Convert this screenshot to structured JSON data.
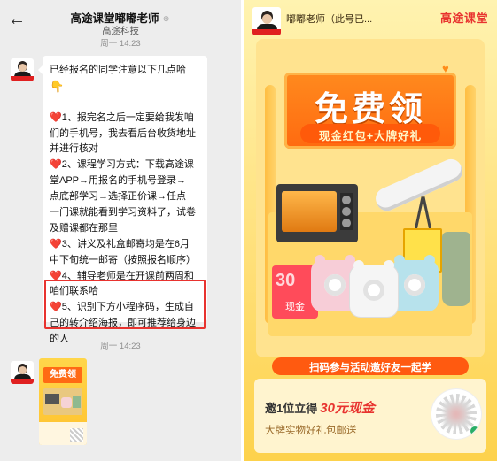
{
  "chat": {
    "title": "高途课堂嘟嘟老师",
    "subtitle": "高途科技",
    "time_top": "周一 14:23",
    "time_bottom": "周一 14:23",
    "back_icon": "←",
    "icons": {
      "back": "chevron-left-icon",
      "work_wechat": "workwechat-badge-icon",
      "heart": "red-heart-icon",
      "point": "point-down-icon"
    },
    "message_lines": [
      "已经报名的同学注意以下几点哈",
      "",
      "",
      "1、报完名之后一定要给我发咱",
      "们的手机号，我去看后台收货地址",
      "并进行核对",
      "2、课程学习方式：下载高途课",
      "堂APP→用报名的手机号登录→",
      "点底部学习→选择正价课→任点",
      "一门课就能看到学习资料了，试卷",
      "及赠课都在那里",
      "3、讲义及礼盒邮寄均是在6月",
      "中下旬统一邮寄（按照报名顺序）",
      "4、辅导老师是在开课前两周和",
      "咱们联系哈",
      "5、识别下方小程序码，生成自",
      "己的转介绍海报，即可推荐给身边",
      "的人"
    ],
    "heart_glyph": "❤️",
    "point_glyph": "👇",
    "highlight_color": "#e8332f",
    "mini_poster_title": "免费领"
  },
  "poster": {
    "teacher": "嘟嘟老师（此号已...",
    "brand": "高途课堂",
    "title": "免费领",
    "subtitle": "现金红包+大牌好礼",
    "coupon_value": "30",
    "coupon_label": "现金",
    "ribbon": "扫码参与活动邀好友一起学",
    "info_line1_prefix": "邀1位立得",
    "info_line1_amount": "30元现金",
    "info_line2": "大牌实物好礼包邮送",
    "colors": {
      "accent": "#e8332f",
      "orange": "#ff6a10",
      "background": "#ffe07a"
    },
    "icons": {
      "heart_left": "orange-heart-icon",
      "heart_right": "orange-heart-icon",
      "qr": "mini-program-qr-icon"
    }
  }
}
